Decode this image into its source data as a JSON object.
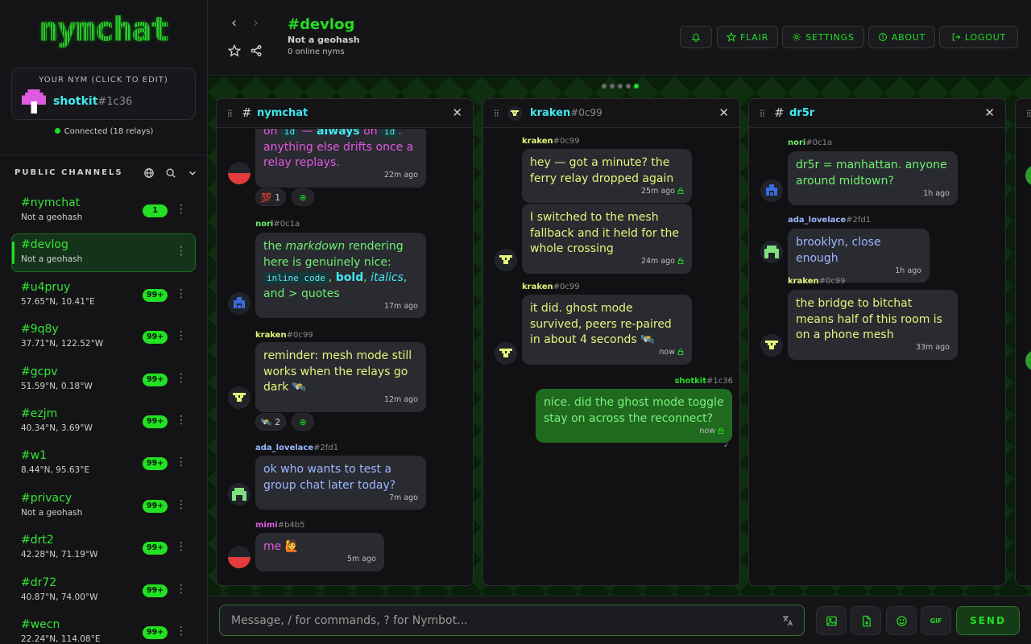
{
  "app": {
    "logo": "nymchat"
  },
  "sidebar": {
    "nym_label": "YOUR NYM (CLICK TO EDIT)",
    "nym_name": "shotkit",
    "nym_tag": "#1c36",
    "connection": "Connected (18 relays)",
    "public_channels_label": "PUBLIC CHANNELS",
    "channels": [
      {
        "name": "#nymchat",
        "sub": "Not a geohash",
        "badge": "1"
      },
      {
        "name": "#devlog",
        "sub": "Not a geohash",
        "badge": ""
      },
      {
        "name": "#u4pruy",
        "sub": "57.65°N, 10.41°E",
        "badge": "99+"
      },
      {
        "name": "#9q8y",
        "sub": "37.71°N, 122.52°W",
        "badge": "99+"
      },
      {
        "name": "#gcpv",
        "sub": "51.59°N, 0.18°W",
        "badge": "99+"
      },
      {
        "name": "#ezjm",
        "sub": "40.34°N, 3.69°W",
        "badge": "99+"
      },
      {
        "name": "#w1",
        "sub": "8.44°N, 95.63°E",
        "badge": "99+"
      },
      {
        "name": "#privacy",
        "sub": "Not a geohash",
        "badge": "99+"
      },
      {
        "name": "#drt2",
        "sub": "42.28°N, 71.19°W",
        "badge": "99+"
      },
      {
        "name": "#dr72",
        "sub": "40.87°N, 74.00°W",
        "badge": "99+"
      },
      {
        "name": "#wecn",
        "sub": "22.24°N, 114.08°E",
        "badge": "99+"
      }
    ]
  },
  "header": {
    "title": "#devlog",
    "subtitle": "Not a geohash",
    "online": "0 online nyms",
    "buttons": {
      "flair": "FLAIR",
      "settings": "SETTINGS",
      "about": "ABOUT",
      "logout": "LOGOUT"
    }
  },
  "panels": {
    "p1": {
      "name": "nymchat",
      "m1": {
        "partial_a": "on ",
        "code_a": "id",
        "partial_b": " — ",
        "bold": "always",
        "partial_c": " on ",
        "code_b": "id",
        "partial_d": ".",
        "line2": "anything else drifts once a relay replays.",
        "time": "22m ago",
        "reaction": "💯 1"
      },
      "m2": {
        "author": "nori",
        "tag": "#0c1a",
        "t1": "the ",
        "em": "markdown",
        "t2": " rendering here is genuinely nice: ",
        "code": "inline code",
        "t3": ", ",
        "bold": "bold",
        "t4": ", ",
        "italic": "italics",
        "t5": ", and > quotes",
        "time": "17m ago"
      },
      "m3": {
        "author": "kraken",
        "tag": "#0c99",
        "text": "reminder: mesh mode still works when the relays go dark 🛰️",
        "time": "12m ago",
        "reaction": "🛰️ 2"
      },
      "m4": {
        "author": "ada_lovelace",
        "tag": "#2fd1",
        "text": "ok who wants to test a group chat later today?",
        "time": "7m ago"
      },
      "m5": {
        "author": "mimi",
        "tag": "#b4b5",
        "text": "me 🙋",
        "time": "5m ago"
      }
    },
    "p2": {
      "name": "kraken",
      "tag": "#0c99",
      "m1": {
        "author": "kraken",
        "tag": "#0c99",
        "text": "hey — got a minute? the ferry relay dropped again",
        "time": "25m ago"
      },
      "m2": {
        "text": "I switched to the mesh fallback and it held for the whole crossing",
        "time": "24m ago"
      },
      "m3": {
        "author": "kraken",
        "tag": "#0c99",
        "text": "it did. ghost mode survived, peers re-paired in about 4 seconds 🛰️",
        "time": "now"
      },
      "m4": {
        "author": "shotkit",
        "tag": "#1c36",
        "text": "nice. did the ghost mode toggle stay on across the reconnect?",
        "time": "now",
        "check": "✓"
      }
    },
    "p3": {
      "name": "dr5r",
      "m1": {
        "author": "nori",
        "tag": "#0c1a",
        "text": "dr5r = manhattan. anyone around midtown?",
        "time": "1h ago"
      },
      "m2": {
        "author": "ada_lovelace",
        "tag": "#2fd1",
        "text": "brooklyn, close enough",
        "time": "1h ago"
      },
      "m3": {
        "author": "kraken",
        "tag": "#0c99",
        "text": "the bridge to bitchat means half of this room is on a phone mesh",
        "time": "33m ago"
      }
    }
  },
  "composer": {
    "placeholder": "Message, / for commands, ? for Nymbot...",
    "send": "SEND",
    "gif": "GIF"
  },
  "colors": {
    "accent": "#22dd22",
    "cyan": "#3ee9ef",
    "magenta": "#e05adf",
    "blue": "#8fb3ff",
    "bubble": "#2a2a31"
  },
  "icons": [
    "globe-icon",
    "search-icon",
    "chevron-down-icon",
    "bell-icon",
    "star-icon",
    "gear-icon",
    "info-icon",
    "logout-icon",
    "share-icon",
    "translate-icon",
    "image-icon",
    "file-icon",
    "emoji-icon",
    "lock-icon",
    "close-icon",
    "drag-handle-icon"
  ]
}
